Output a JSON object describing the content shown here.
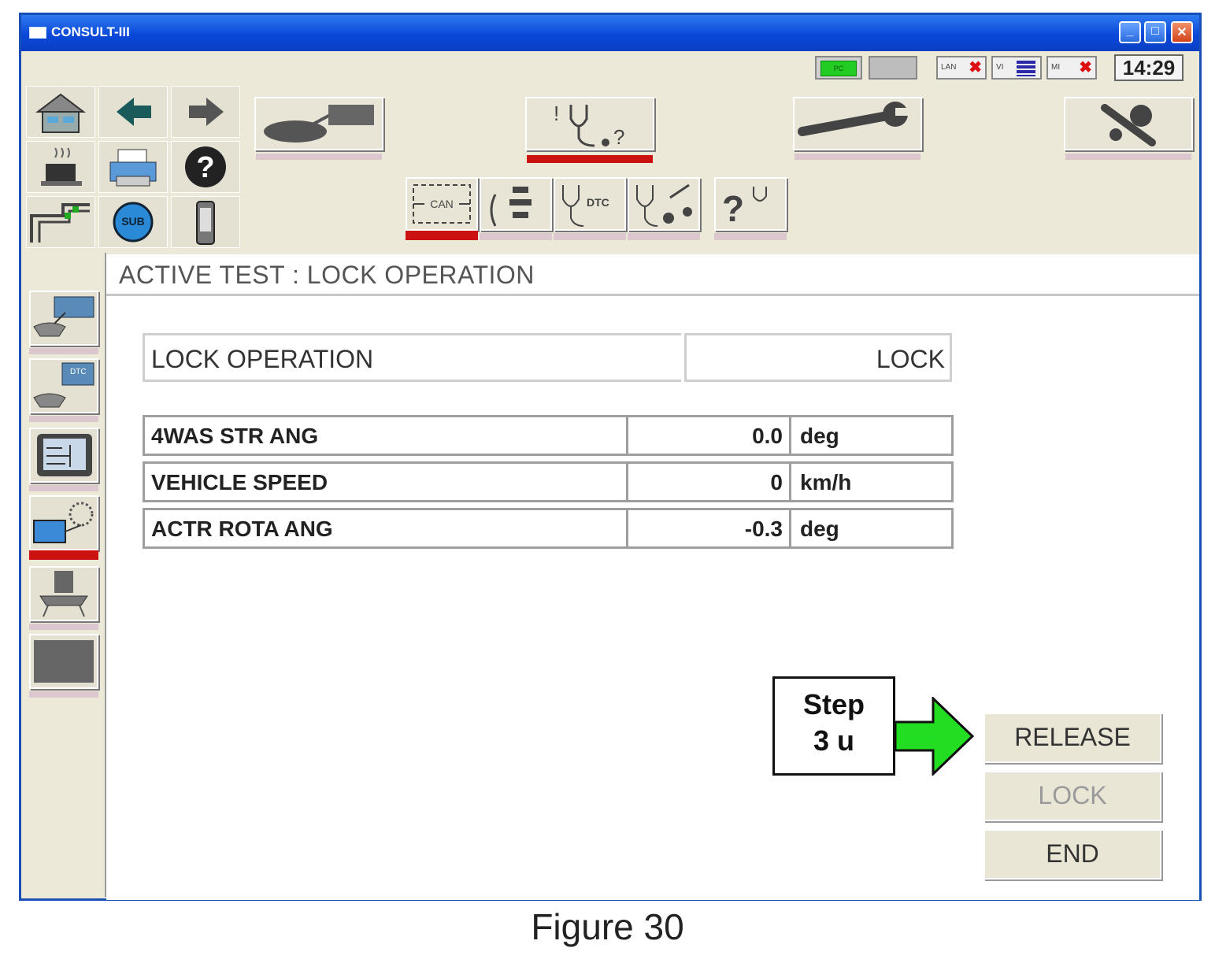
{
  "window": {
    "title": "CONSULT-III"
  },
  "status": {
    "pc_label": "PC",
    "lan_label": "LAN",
    "vi_label": "VI",
    "mi_label": "MI",
    "clock": "14:29"
  },
  "toolbar": {
    "can_label": "CAN",
    "dtc_label": "DTC"
  },
  "nav": {
    "sub_label": "SUB"
  },
  "side": {
    "dtc_label": "DTC"
  },
  "header": {
    "title": "ACTIVE TEST : LOCK OPERATION"
  },
  "operation": {
    "label": "LOCK OPERATION",
    "value": "LOCK"
  },
  "data_rows": [
    {
      "name": "4WAS STR ANG",
      "value": "0.0",
      "unit": "deg"
    },
    {
      "name": "VEHICLE SPEED",
      "value": "0",
      "unit": "km/h"
    },
    {
      "name": "ACTR ROTA ANG",
      "value": "-0.3",
      "unit": "deg"
    }
  ],
  "step": {
    "line1": "Step",
    "line2": "3 u"
  },
  "actions": {
    "release": "RELEASE",
    "lock": "LOCK",
    "end": "END"
  },
  "caption": "Figure 30",
  "colors": {
    "title_bar": "#0a48d8",
    "active_marker": "#cc1111",
    "arrow": "#22dd22"
  }
}
